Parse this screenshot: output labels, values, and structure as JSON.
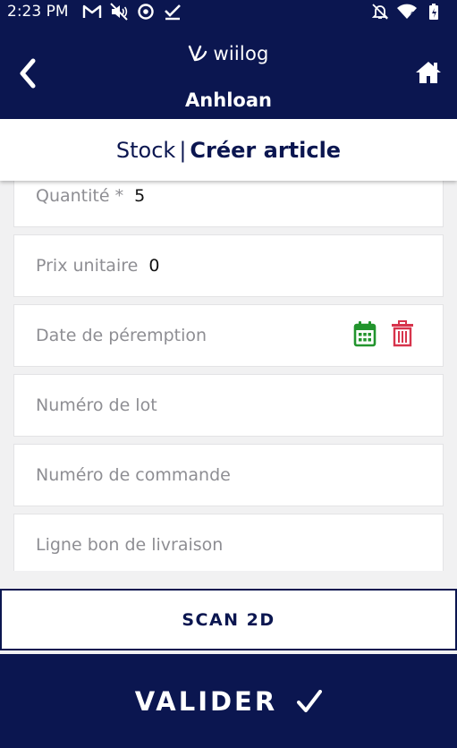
{
  "status_bar": {
    "time": "2:23 PM",
    "left_icons": [
      "gmail-icon",
      "mute-icon",
      "at-sign-icon",
      "check-icon"
    ],
    "right_icons": [
      "notifications-off-icon",
      "wifi-icon",
      "battery-icon"
    ]
  },
  "app_bar": {
    "brand": "wiilog",
    "user": "Anhloan",
    "icons": {
      "back": "chevron-left-icon",
      "home": "home-icon"
    }
  },
  "breadcrumb": {
    "section": "Stock",
    "separator": "|",
    "current": "Créer article"
  },
  "form": {
    "quantity": {
      "label": "Quantité *",
      "value": "5"
    },
    "unit_price": {
      "label": "Prix unitaire",
      "value": "0"
    },
    "expiry_date": {
      "label": "Date de péremption",
      "icons": [
        "calendar-icon",
        "trash-icon"
      ]
    },
    "lot_number": {
      "label": "Numéro de lot"
    },
    "order_number": {
      "label": "Numéro de commande"
    },
    "delivery_note_line": {
      "label": "Ligne bon de livraison"
    }
  },
  "buttons": {
    "scan": "SCAN 2D",
    "validate": "VALIDER",
    "validate_icon": "checkmark-icon"
  },
  "colors": {
    "primary": "#0b1650",
    "calendar": "#22942d",
    "trash": "#d7344c",
    "background": "#f1f1f2"
  }
}
